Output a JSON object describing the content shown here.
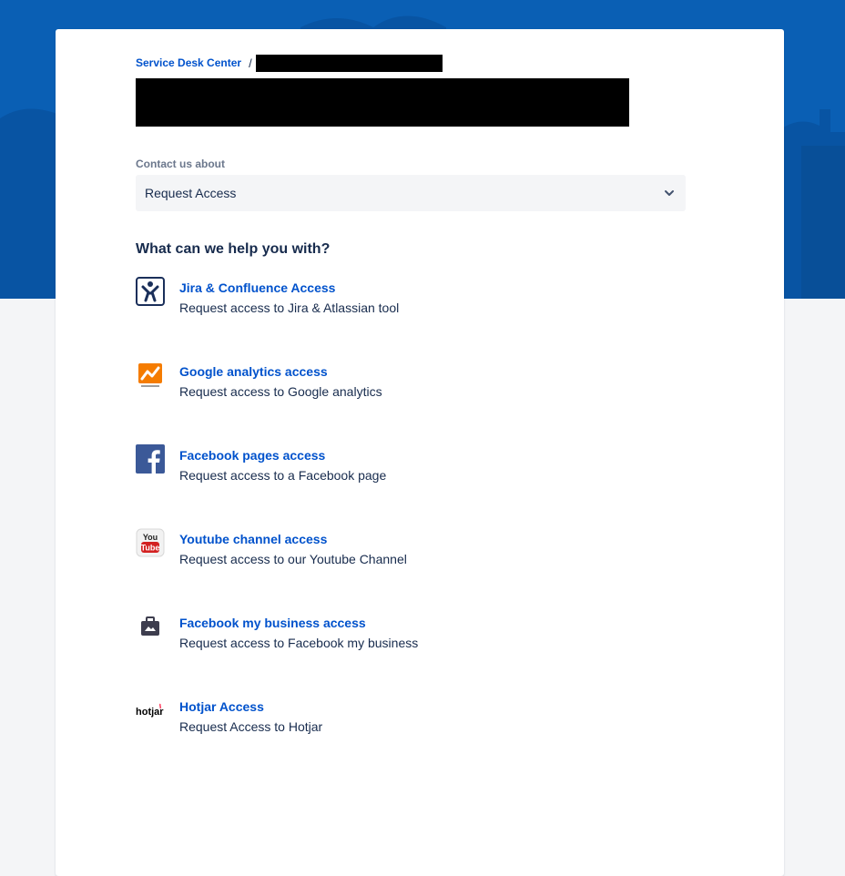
{
  "breadcrumb": {
    "root": "Service Desk Center",
    "separator": "/"
  },
  "contact": {
    "label": "Contact us about",
    "selected": "Request Access"
  },
  "section_heading": "What can we help you with?",
  "requests": [
    {
      "icon": "jira-confluence-icon",
      "title": "Jira & Confluence Access",
      "description": "Request access to Jira & Atlassian tool"
    },
    {
      "icon": "google-analytics-icon",
      "title": "Google analytics access",
      "description": "Request access to Google analytics"
    },
    {
      "icon": "facebook-icon",
      "title": "Facebook pages access",
      "description": "Request access to a Facebook page"
    },
    {
      "icon": "youtube-icon",
      "title": "Youtube channel access",
      "description": "Request access to our Youtube Channel"
    },
    {
      "icon": "briefcase-icon",
      "title": "Facebook my business access",
      "description": "Request access to Facebook my business"
    },
    {
      "icon": "hotjar-icon",
      "title": "Hotjar Access",
      "description": "Request Access to Hotjar"
    }
  ],
  "colors": {
    "banner": "#0a5fb4",
    "link": "#0052cc",
    "text": "#172b4d",
    "muted": "#6b778c"
  }
}
